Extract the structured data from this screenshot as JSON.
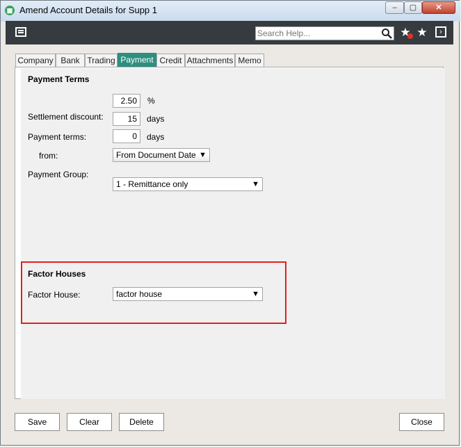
{
  "window": {
    "title": "Amend Account Details for Supp 1",
    "min_glyph": "–",
    "max_glyph": "▢",
    "close_glyph": "✕"
  },
  "toolbar": {
    "search_placeholder": "Search Help...",
    "icons": [
      "menu-icon",
      "search-icon",
      "remove-favourite-icon",
      "favourite-star-icon",
      "expand-icon"
    ]
  },
  "tabs": [
    "Company",
    "Bank",
    "Trading",
    "Payment",
    "Credit",
    "Attachments",
    "Memo"
  ],
  "active_tab": "Payment",
  "payment_terms": {
    "section_title": "Payment Terms",
    "discount_value": "2.50",
    "discount_unit": "%",
    "settlement_label": "Settlement discount:",
    "settlement_value": "15",
    "settlement_unit": "days",
    "terms_label": "Payment terms:",
    "terms_value": "0",
    "terms_unit": "days",
    "from_label": "from:",
    "from_value": "From Document Date",
    "group_label": "Payment Group:",
    "group_value": "1 - Remittance only"
  },
  "factor_houses": {
    "section_title": "Factor Houses",
    "label": "Factor House:",
    "value": "factor house"
  },
  "buttons": {
    "save": "Save",
    "clear": "Clear",
    "delete": "Delete",
    "close": "Close"
  },
  "colors": {
    "active_tab": "#2e8e7f",
    "toolbar": "#353b3f",
    "highlight": "#e02020"
  }
}
